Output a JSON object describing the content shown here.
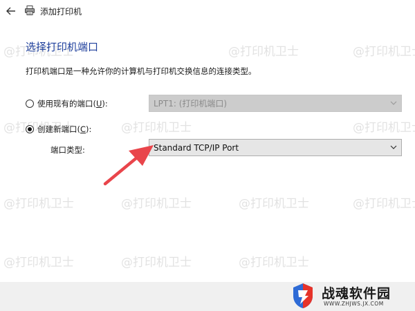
{
  "window": {
    "title": "添加打印机"
  },
  "page": {
    "heading": "选择打印机端口",
    "description": "打印机端口是一种允许你的计算机与打印机交换信息的连接类型。"
  },
  "options": {
    "existing_port": {
      "label_prefix": "使用现有的端口(",
      "accelerator": "U",
      "label_suffix": "):",
      "selected": false,
      "value": "LPT1: (打印机端口)",
      "enabled": false
    },
    "new_port": {
      "label_prefix": "创建新端口(",
      "accelerator": "C",
      "label_suffix": "):",
      "selected": true
    }
  },
  "port_type": {
    "label": "端口类型:",
    "value": "Standard TCP/IP Port"
  },
  "watermark": {
    "text": "@打印机卫士"
  },
  "branding": {
    "name": "战魂软件园",
    "url": "WWW.ZHJWS.JX.COM"
  },
  "colors": {
    "heading": "#1e3f9c",
    "arrow": "#e9454b",
    "logo_red": "#e6332a",
    "logo_blue": "#2e6bd6"
  },
  "icons": {
    "back": "back-arrow-icon",
    "printer": "printer-icon",
    "chevron": "chevron-down-icon"
  }
}
